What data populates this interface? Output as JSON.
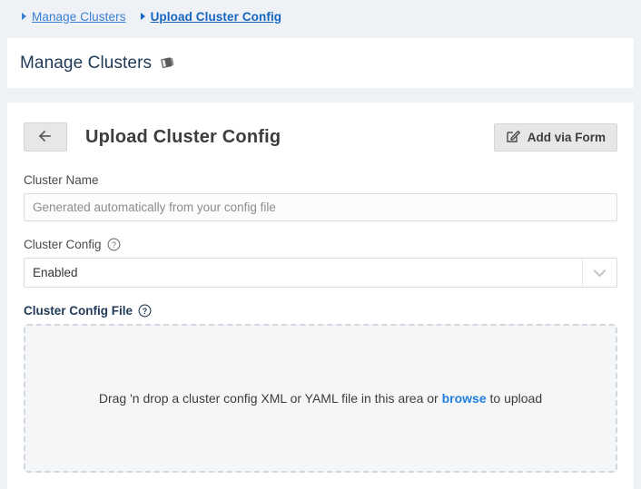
{
  "breadcrumb": {
    "items": [
      {
        "label": "Manage Clusters",
        "icon": "caret-right-icon"
      },
      {
        "label": "Upload Cluster Config",
        "icon": "caret-right-icon"
      }
    ]
  },
  "header": {
    "title": "Manage Clusters",
    "icon": "manual-book-icon"
  },
  "card": {
    "back_button_icon": "arrow-left-icon",
    "title": "Upload Cluster Config",
    "add_via_form": {
      "label": "Add via Form",
      "icon": "edit-square-icon"
    }
  },
  "form": {
    "cluster_name": {
      "label": "Cluster Name",
      "value": "",
      "placeholder": "Generated automatically from your config file"
    },
    "cluster_config": {
      "label": "Cluster Config",
      "help_icon": "question-circle-icon",
      "selected": "Enabled",
      "options": [
        "Enabled"
      ],
      "arrow_icon": "chevron-down-icon"
    },
    "cluster_config_file": {
      "label": "Cluster Config File",
      "help_icon": "question-circle-icon",
      "dropzone": {
        "text_before": "Drag 'n drop a cluster config XML or YAML file in this area or ",
        "link": "browse",
        "text_after": " to upload"
      }
    }
  },
  "colors": {
    "page_background": "#eef1f6",
    "card_background": "#ffffff",
    "breadcrumb_link": "#3b7fd4",
    "breadcrumb_active": "#1565c0",
    "title_navy": "#1f3a56",
    "link_blue": "#1f7fe0",
    "button_face": "#e7e7e7",
    "dropzone_fill": "#f5f6f8",
    "dropzone_border": "#d2d6de"
  }
}
